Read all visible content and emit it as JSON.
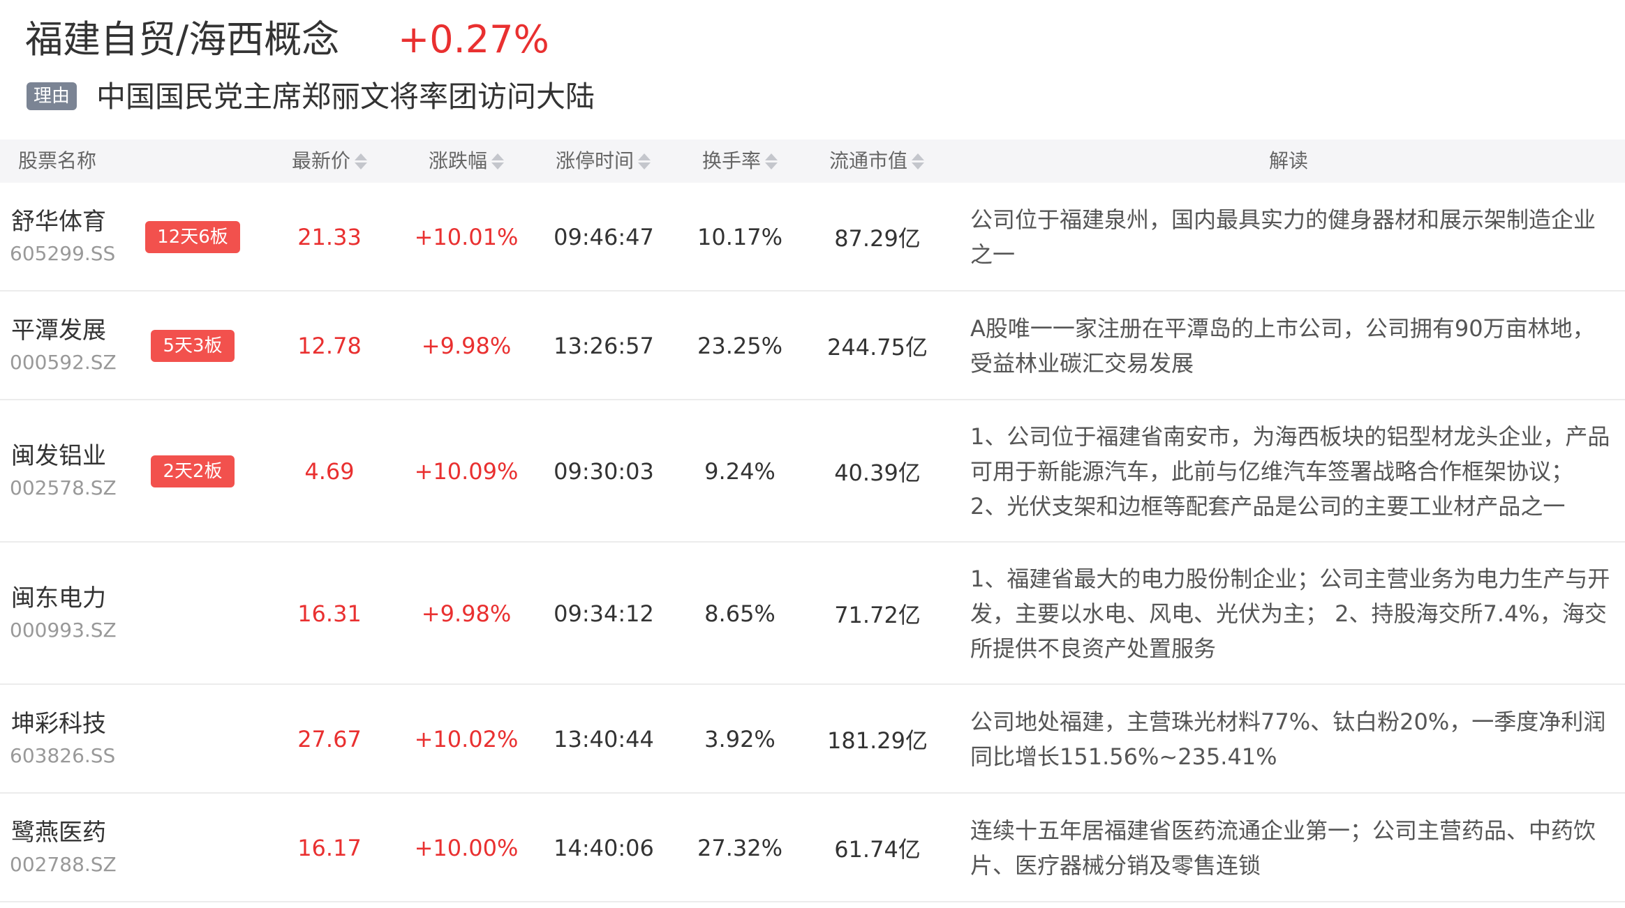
{
  "header": {
    "title": "福建自贸/海西概念",
    "change": "+0.27%",
    "reason_tag": "理由",
    "reason_text": "中国国民党主席郑丽文将率团访问大陆"
  },
  "colors": {
    "up": "#e93030",
    "badge": "#f2514d",
    "tag": "#7b8494"
  },
  "table": {
    "columns": [
      "股票名称",
      "最新价",
      "涨跌幅",
      "涨停时间",
      "换手率",
      "流通市值",
      "解读"
    ],
    "rows": [
      {
        "name": "舒华体育",
        "code": "605299.SS",
        "badge": "12天6板",
        "price": "21.33",
        "change": "+10.01%",
        "time": "09:46:47",
        "turnover": "10.17%",
        "market_cap": "87.29亿",
        "desc": "公司位于福建泉州，国内最具实力的健身器材和展示架制造企业之一"
      },
      {
        "name": "平潭发展",
        "code": "000592.SZ",
        "badge": "5天3板",
        "price": "12.78",
        "change": "+9.98%",
        "time": "13:26:57",
        "turnover": "23.25%",
        "market_cap": "244.75亿",
        "desc": "A股唯一一家注册在平潭岛的上市公司，公司拥有90万亩林地，受益林业碳汇交易发展"
      },
      {
        "name": "闽发铝业",
        "code": "002578.SZ",
        "badge": "2天2板",
        "price": "4.69",
        "change": "+10.09%",
        "time": "09:30:03",
        "turnover": "9.24%",
        "market_cap": "40.39亿",
        "desc": "1、公司位于福建省南安市，为海西板块的铝型材龙头企业，产品可用于新能源汽车，此前与亿维汽车签署战略合作框架协议； 2、光伏支架和边框等配套产品是公司的主要工业材产品之一"
      },
      {
        "name": "闽东电力",
        "code": "000993.SZ",
        "badge": "",
        "price": "16.31",
        "change": "+9.98%",
        "time": "09:34:12",
        "turnover": "8.65%",
        "market_cap": "71.72亿",
        "desc": "1、福建省最大的电力股份制企业；公司主营业务为电力生产与开发，主要以水电、风电、光伏为主； 2、持股海交所7.4%，海交所提供不良资产处置服务"
      },
      {
        "name": "坤彩科技",
        "code": "603826.SS",
        "badge": "",
        "price": "27.67",
        "change": "+10.02%",
        "time": "13:40:44",
        "turnover": "3.92%",
        "market_cap": "181.29亿",
        "desc": "公司地处福建，主营珠光材料77%、钛白粉20%，一季度净利润同比增长151.56%~235.41%"
      },
      {
        "name": "鹭燕医药",
        "code": "002788.SZ",
        "badge": "",
        "price": "16.17",
        "change": "+10.00%",
        "time": "14:40:06",
        "turnover": "27.32%",
        "market_cap": "61.74亿",
        "desc": "连续十五年居福建省医药流通企业第一；公司主营药品、中药饮片、医疗器械分销及零售连锁"
      }
    ]
  }
}
